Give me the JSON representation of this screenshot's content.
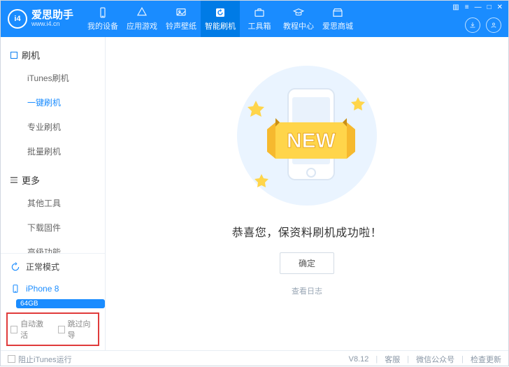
{
  "brand": {
    "logo_text": "i4",
    "title": "爱思助手",
    "subtitle": "www.i4.cn"
  },
  "nav": {
    "items": [
      {
        "label": "我的设备"
      },
      {
        "label": "应用游戏"
      },
      {
        "label": "铃声壁纸"
      },
      {
        "label": "智能刷机"
      },
      {
        "label": "工具箱"
      },
      {
        "label": "教程中心"
      },
      {
        "label": "爱思商城"
      }
    ]
  },
  "sidebar": {
    "group1": {
      "label": "刷机"
    },
    "items1": [
      {
        "label": "iTunes刷机"
      },
      {
        "label": "一键刷机"
      },
      {
        "label": "专业刷机"
      },
      {
        "label": "批量刷机"
      }
    ],
    "group2": {
      "label": "更多"
    },
    "items2": [
      {
        "label": "其他工具"
      },
      {
        "label": "下载固件"
      },
      {
        "label": "高级功能"
      }
    ],
    "mode": "正常模式",
    "device": {
      "name": "iPhone 8",
      "capacity": "64GB"
    },
    "opts": {
      "auto": "自动激活",
      "skip": "跳过向导"
    }
  },
  "main": {
    "message": "恭喜您，保资料刷机成功啦！",
    "ok": "确定",
    "view_log": "查看日志",
    "new_badge": "NEW"
  },
  "status": {
    "block_itunes": "阻止iTunes运行",
    "version": "V8.12",
    "support": "客服",
    "wechat": "微信公众号",
    "update": "检查更新"
  }
}
